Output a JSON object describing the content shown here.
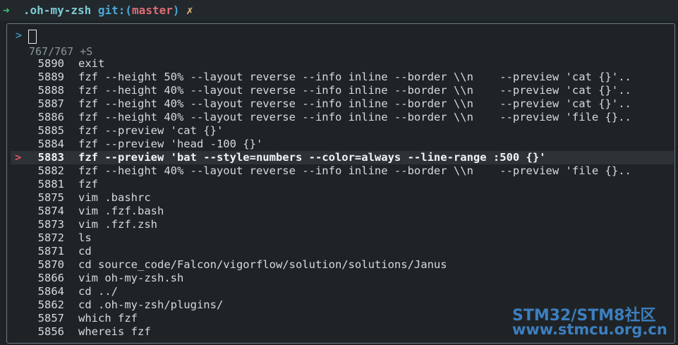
{
  "prompt": {
    "ghost": "                        ",
    "arrow": "➜",
    "directory": ".oh-my-zsh",
    "git_label": "git:(",
    "branch": "master",
    "git_close": ")",
    "dirty_mark": "✗"
  },
  "fzf": {
    "prompt_symbol": ">",
    "info": "767/767 +S",
    "selected_pointer": ">",
    "rows": [
      {
        "num": "5890",
        "cmd": "exit"
      },
      {
        "num": "5889",
        "cmd": "fzf --height 50% --layout reverse --info inline --border \\\\n    --preview 'cat {}'.."
      },
      {
        "num": "5888",
        "cmd": "fzf --height 40% --layout reverse --info inline --border \\\\n    --preview 'cat {}'.."
      },
      {
        "num": "5887",
        "cmd": "fzf --height 40% --layout reverse --info inline --border \\\\n    --preview 'cat {}'.."
      },
      {
        "num": "5886",
        "cmd": "fzf --height 40% --layout reverse --info inline --border \\\\n    --preview 'file {}.."
      },
      {
        "num": "5885",
        "cmd": "fzf --preview 'cat {}'"
      },
      {
        "num": "5884",
        "cmd": "fzf --preview 'head -100 {}'"
      },
      {
        "num": "5883",
        "cmd": "fzf --preview 'bat --style=numbers --color=always --line-range :500 {}'",
        "selected": true
      },
      {
        "num": "5882",
        "cmd": "fzf --height 40% --layout reverse --info inline --border \\\\n    --preview 'file {}.."
      },
      {
        "num": "5881",
        "cmd": "fzf"
      },
      {
        "num": "5875",
        "cmd": "vim .bashrc"
      },
      {
        "num": "5874",
        "cmd": "vim .fzf.bash"
      },
      {
        "num": "5873",
        "cmd": "vim .fzf.zsh"
      },
      {
        "num": "5872",
        "cmd": "ls"
      },
      {
        "num": "5871",
        "cmd": "cd"
      },
      {
        "num": "5870",
        "cmd": "cd source_code/Falcon/vigorflow/solution/solutions/Janus"
      },
      {
        "num": "5866",
        "cmd": "vim oh-my-zsh.sh"
      },
      {
        "num": "5864",
        "cmd": "cd ../"
      },
      {
        "num": "5862",
        "cmd": "cd .oh-my-zsh/plugins/"
      },
      {
        "num": "5857",
        "cmd": "which fzf"
      },
      {
        "num": "5856",
        "cmd": "whereis fzf"
      }
    ]
  },
  "watermark": {
    "line1": "STM32/STM8社区",
    "line2": "www.stmcu.org.cn"
  }
}
